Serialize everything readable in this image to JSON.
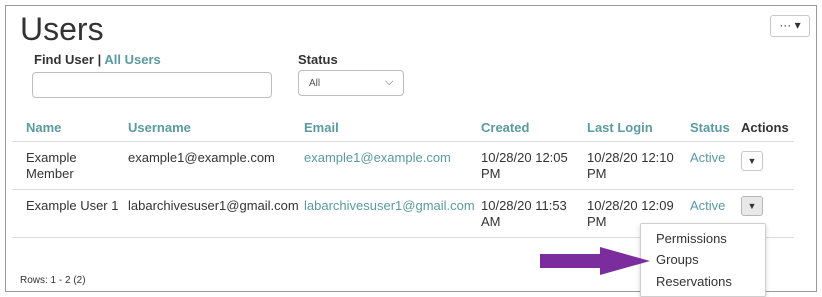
{
  "page": {
    "title": "Users",
    "more_label": "··· ▾"
  },
  "filters": {
    "find_user_label": "Find User",
    "separator": "|",
    "all_users_link": "All Users",
    "search_value": "",
    "status_label": "Status",
    "status_selected": "All"
  },
  "table": {
    "columns": [
      "Name",
      "Username",
      "Email",
      "Created",
      "Last Login",
      "Status",
      "Actions"
    ],
    "rows": [
      {
        "name": "Example Member",
        "name_line1": "Example",
        "name_line2": "Member",
        "username": "example1@example.com",
        "email": "example1@example.com",
        "created_line1": "10/28/20 12:05",
        "created_line2": "PM",
        "last_login_line1": "10/28/20 12:10",
        "last_login_line2": "PM",
        "status": "Active"
      },
      {
        "name": "Example User 1",
        "username": "labarchivesuser1@gmail.com",
        "email": "labarchivesuser1@gmail.com",
        "created_line1": "10/28/20 11:53",
        "created_line2": "AM",
        "last_login_line1": "10/28/20 12:09",
        "last_login_line2": "PM",
        "status": "Active"
      }
    ]
  },
  "footer": {
    "rows_info": "Rows: 1 - 2 (2)"
  },
  "actions_menu": {
    "items": [
      "Permissions",
      "Groups",
      "Reservations"
    ]
  },
  "colors": {
    "accent": "#5b9aa0",
    "annotation_arrow": "#7b2d9e",
    "text": "#333333"
  }
}
